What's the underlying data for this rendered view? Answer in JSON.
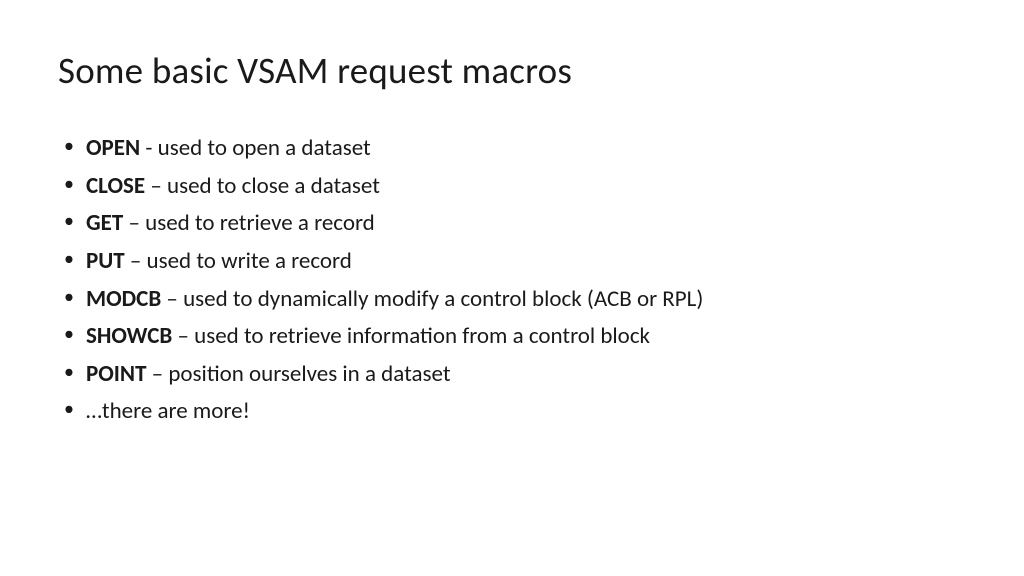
{
  "title": "Some basic VSAM request macros",
  "items": [
    {
      "name": "OPEN",
      "sep": " - ",
      "desc": "used to open a dataset"
    },
    {
      "name": "CLOSE",
      "sep": " – ",
      "desc": "used to close a dataset"
    },
    {
      "name": "GET",
      "sep": " – ",
      "desc": "used to retrieve a record"
    },
    {
      "name": "PUT",
      "sep": " – ",
      "desc": "used to write a record"
    },
    {
      "name": "MODCB",
      "sep": " – ",
      "desc": "used to dynamically modify a control block (ACB or RPL)"
    },
    {
      "name": "SHOWCB",
      "sep": " – ",
      "desc": "used to retrieve information from a control block"
    },
    {
      "name": "POINT",
      "sep": " – ",
      "desc": "position ourselves in a dataset"
    }
  ],
  "footer_item": "…there are more!"
}
